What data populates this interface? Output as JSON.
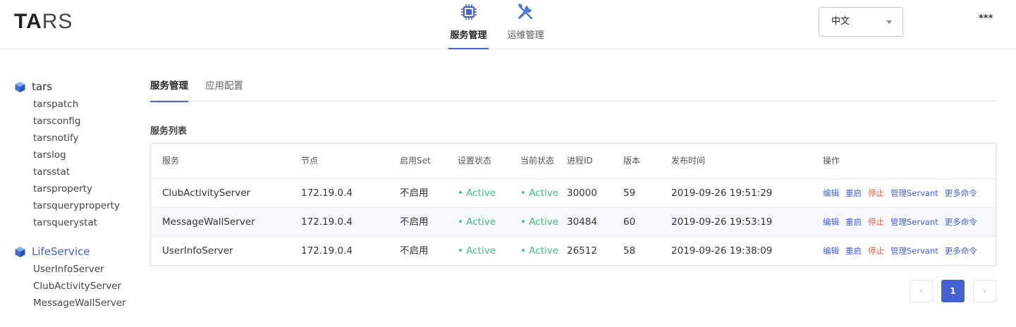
{
  "brand": {
    "logo_bold": "TA",
    "logo_light": "RS"
  },
  "topnav": {
    "items": [
      {
        "label": "服务管理",
        "icon": "chip-icon",
        "active": true
      },
      {
        "label": "运维管理",
        "icon": "tools-icon",
        "active": false
      }
    ]
  },
  "language": {
    "selected": "中文"
  },
  "more_menu": "***",
  "sidebar": {
    "apps": [
      {
        "name": "tars",
        "servers": [
          "tarspatch",
          "tarsconfig",
          "tarsnotify",
          "tarslog",
          "tarsstat",
          "tarsproperty",
          "tarsqueryproperty",
          "tarsquerystat"
        ]
      },
      {
        "name": "LifeService",
        "servers": [
          "UserInfoServer",
          "ClubActivityServer",
          "MessageWallServer"
        ]
      }
    ]
  },
  "tabs": [
    {
      "label": "服务管理",
      "active": true
    },
    {
      "label": "应用配置",
      "active": false
    }
  ],
  "section_title": "服务列表",
  "table": {
    "headers": [
      "服务",
      "节点",
      "启用Set",
      "设置状态",
      "当前状态",
      "进程ID",
      "版本",
      "发布时间",
      "操作"
    ],
    "rows": [
      [
        "ClubActivityServer",
        "172.19.0.4",
        "不启用",
        "• Active",
        "• Active",
        "30000",
        "59",
        "2019-09-26 19:51:29"
      ],
      [
        "MessageWallServer",
        "172.19.0.4",
        "不启用",
        "• Active",
        "• Active",
        "30484",
        "60",
        "2019-09-26 19:53:19"
      ],
      [
        "UserInfoServer",
        "172.19.0.4",
        "不启用",
        "• Active",
        "• Active",
        "26512",
        "58",
        "2019-09-26 19:38:09"
      ]
    ],
    "actions": [
      "编辑",
      "重启",
      "停止",
      "管理Servant",
      "更多命令"
    ]
  },
  "pagination": {
    "prev": "‹",
    "current": "1",
    "next": "›"
  },
  "colors": {
    "accent": "#4461d2",
    "active_status": "#3fbf7f",
    "stop": "#e0593e"
  }
}
